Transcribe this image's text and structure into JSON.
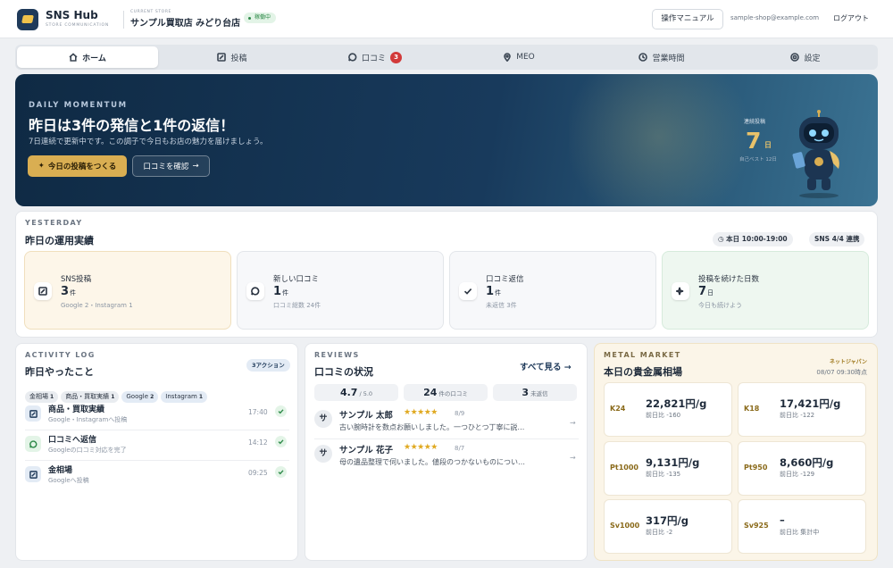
{
  "header": {
    "brand": "SNS Hub",
    "brand_sub": "STORE COMMUNICATION",
    "store_caption": "CURRENT STORE",
    "store_name": "サンプル買取店 みどり台店",
    "status": "稼働中",
    "manual": "操作マニュアル",
    "email": "sample-shop@example.com",
    "logout": "ログアウト"
  },
  "nav": {
    "tabs": [
      {
        "label": "ホーム",
        "icon": "home-icon"
      },
      {
        "label": "投稿",
        "icon": "edit-icon"
      },
      {
        "label": "口コミ",
        "icon": "chat-icon",
        "badge": "3"
      },
      {
        "label": "MEO",
        "icon": "location-icon"
      },
      {
        "label": "営業時間",
        "icon": "clock-icon"
      },
      {
        "label": "設定",
        "icon": "settings-icon"
      }
    ]
  },
  "hero": {
    "kicker": "DAILY MOMENTUM",
    "title": "昨日は3件の発信と1件の返信！",
    "subtitle": "7日連続で更新中です。この調子で今日もお店の魅力を届けましょう。",
    "primary_btn": "今日の投稿をつくる",
    "secondary_btn": "口コミを確認",
    "streak_label": "連続投稿",
    "streak_value": "7",
    "streak_unit": "日",
    "streak_best": "自己ベスト 12日"
  },
  "yesterday": {
    "kicker": "YESTERDAY",
    "title": "昨日の運用実績",
    "hours": "本日 10:00-19:00",
    "sns": "SNS 4/4 連携",
    "stats": [
      {
        "label": "SNS投稿",
        "value": "3",
        "unit": "件",
        "note": "Google 2・Instagram 1",
        "icon": "edit-icon"
      },
      {
        "label": "新しい口コミ",
        "value": "1",
        "unit": "件",
        "note": "口コミ総数 24件",
        "icon": "chat-icon"
      },
      {
        "label": "口コミ返信",
        "value": "1",
        "unit": "件",
        "note": "未返信 3件",
        "icon": "check-icon"
      },
      {
        "label": "投稿を続けた日数",
        "value": "7",
        "unit": "日",
        "note": "今日も続けよう",
        "icon": "sparkle-icon"
      }
    ]
  },
  "activity": {
    "kicker": "ACTIVITY LOG",
    "title": "昨日やったこと",
    "badge": "3アクション",
    "chips": [
      {
        "label": "金相場",
        "count": "1"
      },
      {
        "label": "商品・買取実績",
        "count": "1"
      },
      {
        "label": "Google",
        "count": "2"
      },
      {
        "label": "Instagram",
        "count": "1"
      }
    ],
    "items": [
      {
        "title": "商品・買取実績",
        "sub": "Google・Instagramへ投稿",
        "time": "17:40"
      },
      {
        "title": "口コミへ返信",
        "sub": "Googleの口コミ対応を完了",
        "time": "14:12"
      },
      {
        "title": "金相場",
        "sub": "Googleへ投稿",
        "time": "09:25"
      }
    ]
  },
  "reviews": {
    "kicker": "REVIEWS",
    "title": "口コミの状況",
    "see_all": "すべて見る",
    "stats": [
      {
        "value": "4.7",
        "unit": "/ 5.0"
      },
      {
        "value": "24",
        "unit": "件の口コミ"
      },
      {
        "value": "3",
        "unit": "未返信"
      }
    ],
    "items": [
      {
        "avatar": "サ",
        "name": "サンプル 太郎",
        "stars": "★★★★★",
        "date": "8/9",
        "text": "古い腕時計を数点お願いしました。一つひとつ丁寧に説…"
      },
      {
        "avatar": "サ",
        "name": "サンプル 花子",
        "stars": "★★★★★",
        "date": "8/7",
        "text": "母の遺品整理で伺いました。値段のつかないものについ…"
      }
    ]
  },
  "market": {
    "kicker": "METAL MARKET",
    "title": "本日の貴金属相場",
    "source": "ネットジャパン",
    "updated": "08/07 09:30時点",
    "items": [
      {
        "code": "K24",
        "price": "22,821円/g",
        "change": "前日比 -160"
      },
      {
        "code": "K18",
        "price": "17,421円/g",
        "change": "前日比 -122"
      },
      {
        "code": "Pt1000",
        "price": "9,131円/g",
        "change": "前日比 -135"
      },
      {
        "code": "Pt950",
        "price": "8,660円/g",
        "change": "前日比 -129"
      },
      {
        "code": "Sv1000",
        "price": "317円/g",
        "change": "前日比 -2"
      },
      {
        "code": "Sv925",
        "price": "–",
        "change": "前日比 集計中"
      }
    ]
  },
  "colors": {
    "accent": "#d9ae52",
    "navy": "#183a5c",
    "danger": "#d23a3a",
    "success": "#2f8a4a"
  }
}
